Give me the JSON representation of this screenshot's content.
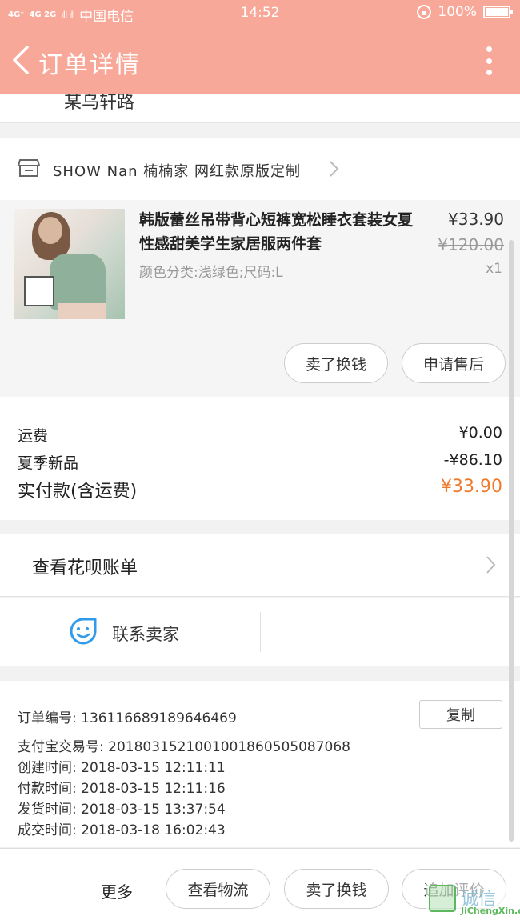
{
  "status_bar": {
    "network_1": "4G⁺",
    "network_2": "4G 2G",
    "signal": "ıll ıll",
    "carrier": "中国电信",
    "time": "14:52",
    "battery": "100%",
    "battery_level": 1.0
  },
  "nav": {
    "title": "订单详情",
    "back_icon": "chevron-left-icon",
    "more_icon": "vertical-dots-icon"
  },
  "address": {
    "clipped_text": "某乌轩路"
  },
  "shop": {
    "name": "SHOW Nan 楠楠家 网红款原版定制",
    "icon": "store-icon"
  },
  "product": {
    "title": "韩版蕾丝吊带背心短裤宽松睡衣套装女夏性感甜美学生家居服两件套",
    "spec": "颜色分类:浅绿色;尺码:L",
    "price": "¥33.90",
    "original_price": "¥120.00",
    "quantity": "x1",
    "sell_button": "卖了换钱",
    "aftersale_button": "申请售后"
  },
  "fees": {
    "shipping_label": "运费",
    "shipping_value": "¥0.00",
    "promo_label": "夏季新品",
    "promo_value": "-¥86.10",
    "total_label": "实付款(含运费)",
    "total_value": "¥33.90",
    "accent_color": "#f07a2c"
  },
  "huabei": {
    "label": "查看花呗账单"
  },
  "contact": {
    "label": "联系卖家",
    "icon": "smile-chat-icon",
    "icon_color": "#2f9bea"
  },
  "order_info": {
    "order_no": "订单编号: 136116689189646469",
    "copy_button": "复制",
    "alipay_no": "支付宝交易号: 2018031521001001860505087068",
    "created": "创建时间: 2018-03-15 12:11:11",
    "paid": "付款时间: 2018-03-15 12:11:16",
    "shipped": "发货时间: 2018-03-15 13:37:54",
    "completed": "成交时间: 2018-03-18 16:02:43"
  },
  "bottom_bar": {
    "more": "更多",
    "logistics": "查看物流",
    "sell": "卖了换钱",
    "review": "追加评价"
  },
  "watermark": {
    "cn": "诚信",
    "en": "JiChengXin.com"
  },
  "colors": {
    "header_bg": "#f7a899"
  }
}
